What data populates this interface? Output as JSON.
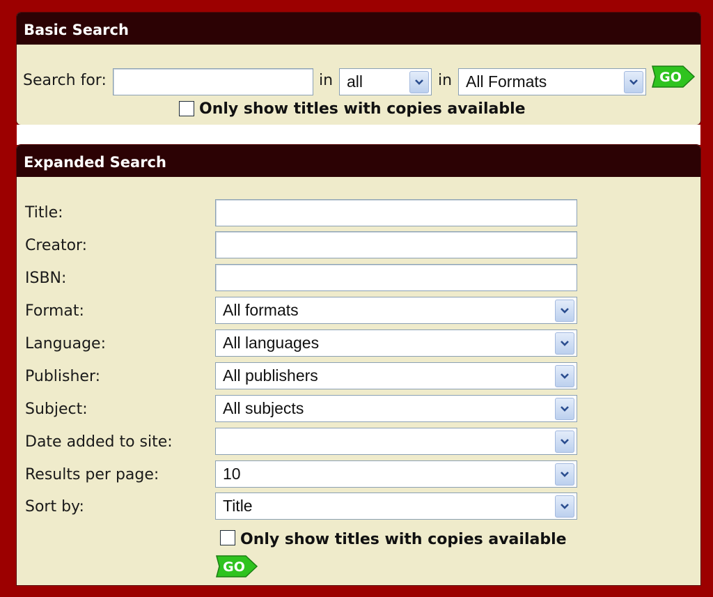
{
  "basic": {
    "title": "Basic Search",
    "search_for_label": "Search for:",
    "search_value": "",
    "in_label_1": "in",
    "field_select_value": "all",
    "in_label_2": "in",
    "format_select_value": "All Formats",
    "available_only_label": "Only show titles with copies available",
    "go_label": "GO"
  },
  "expanded": {
    "title": "Expanded Search",
    "fields": {
      "title": {
        "label": "Title:",
        "value": ""
      },
      "creator": {
        "label": "Creator:",
        "value": ""
      },
      "isbn": {
        "label": "ISBN:",
        "value": ""
      },
      "format": {
        "label": "Format:",
        "value": "All formats"
      },
      "language": {
        "label": "Language:",
        "value": "All languages"
      },
      "publisher": {
        "label": "Publisher:",
        "value": "All publishers"
      },
      "subject": {
        "label": "Subject:",
        "value": "All subjects"
      },
      "date_added": {
        "label": "Date added to site:",
        "value": ""
      },
      "results_per_page": {
        "label": "Results per page:",
        "value": "10"
      },
      "sort_by": {
        "label": "Sort by:",
        "value": "Title"
      }
    },
    "available_only_label": "Only show titles with copies available",
    "go_label": "GO"
  },
  "colors": {
    "frame": "#9c0000",
    "header": "#2c0204",
    "panel": "#efebcb",
    "go_green": "#2fc31f"
  },
  "icons": {
    "go": "arrow-shaped green GO button",
    "dropdown": "chevron-down-icon"
  }
}
